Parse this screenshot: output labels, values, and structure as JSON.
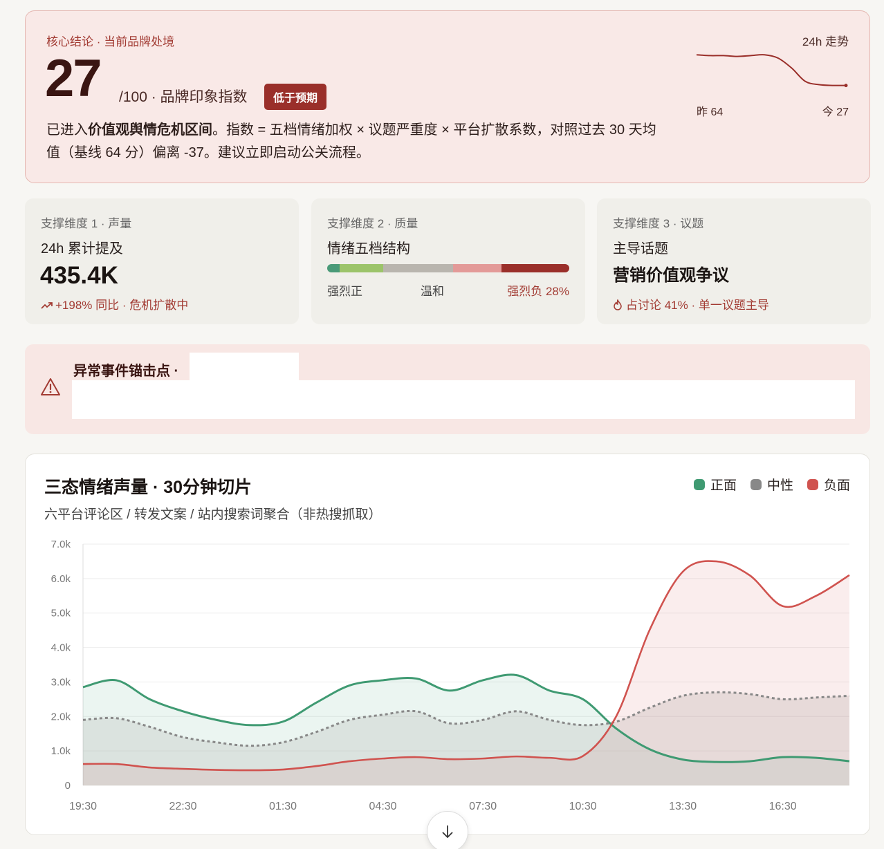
{
  "hero": {
    "kicker": "核心结论 · 当前品牌处境",
    "score": "27",
    "unit": "/100 · 品牌印象指数",
    "badge": "低于预期",
    "desc_pre": "已进入",
    "desc_bold": "价值观舆情危机区间",
    "desc_post": "。指数 = 五档情绪加权 × 议题严重度 × 平台扩散系数，对照过去 30 天均值（基线 64 分）偏离 -37。建议立即启动公关流程。",
    "trend_label": "24h 走势",
    "trend_left": "昨 64",
    "trend_right": "今 27",
    "trend_values": [
      64,
      63,
      63,
      62,
      63,
      64,
      60,
      48,
      32,
      28,
      27,
      27
    ],
    "accent": "#9a2f2a"
  },
  "cards": {
    "volume": {
      "kicker": "支撑维度 1 · 声量",
      "sub": "24h 累计提及",
      "value": "435.4K",
      "note": "+198% 同比 · 危机扩散中"
    },
    "quality": {
      "kicker": "支撑维度 2 · 质量",
      "sub": "情绪五档结构",
      "segments": [
        {
          "name": "强烈正",
          "share": 0.05,
          "color": "#4a9a78"
        },
        {
          "name": "正",
          "share": 0.18,
          "color": "#9cc46a"
        },
        {
          "name": "温和",
          "share": 0.29,
          "color": "#b9b5ae"
        },
        {
          "name": "负",
          "share": 0.2,
          "color": "#e39a98"
        },
        {
          "name": "强烈负",
          "share": 0.28,
          "color": "#9a2f2a"
        }
      ],
      "label_left": "强烈正",
      "label_mid": "温和",
      "label_right": "强烈负 28%"
    },
    "topic": {
      "kicker": "支撑维度 3 · 议题",
      "sub": "主导话题",
      "value": "营销价值观争议",
      "note": "占讨论 41% · 单一议题主导"
    }
  },
  "alert": {
    "title": "异常事件锚击点 ·"
  },
  "chart_card": {
    "title": "三态情绪声量 · 30分钟切片",
    "subtitle": "六平台评论区 / 转发文案 / 站内搜索词聚合（非热搜抓取）"
  },
  "chart_data": {
    "type": "area",
    "x": [
      "19:30",
      "20:30",
      "21:30",
      "22:30",
      "23:30",
      "00:30",
      "01:30",
      "02:30",
      "03:30",
      "04:30",
      "05:30",
      "06:30",
      "07:30",
      "08:30",
      "09:30",
      "10:30",
      "11:30",
      "12:30",
      "13:30",
      "14:30",
      "15:30",
      "16:30",
      "17:30",
      "18:30"
    ],
    "tick_labels": [
      "19:30",
      "22:30",
      "01:30",
      "04:30",
      "07:30",
      "10:30",
      "13:30",
      "16:30"
    ],
    "ylim": [
      0,
      7000
    ],
    "yticks": [
      "0",
      "1.0k",
      "2.0k",
      "3.0k",
      "4.0k",
      "5.0k",
      "6.0k",
      "7.0k"
    ],
    "series": [
      {
        "name": "正面",
        "color": "#3f9a72",
        "values": [
          2850,
          3050,
          2500,
          2150,
          1900,
          1750,
          1850,
          2400,
          2900,
          3050,
          3100,
          2750,
          3050,
          3200,
          2750,
          2500,
          1650,
          1050,
          750,
          680,
          700,
          820,
          800,
          700
        ]
      },
      {
        "name": "中性",
        "color": "#888888",
        "values": [
          1900,
          1950,
          1700,
          1400,
          1250,
          1150,
          1250,
          1550,
          1900,
          2050,
          2150,
          1800,
          1900,
          2150,
          1900,
          1750,
          1850,
          2250,
          2600,
          2700,
          2650,
          2500,
          2550,
          2600
        ]
      },
      {
        "name": "负面",
        "color": "#d0534f",
        "values": [
          620,
          620,
          520,
          480,
          450,
          440,
          460,
          560,
          700,
          780,
          820,
          760,
          780,
          840,
          800,
          850,
          2000,
          4500,
          6200,
          6500,
          6100,
          5200,
          5500,
          6100
        ]
      }
    ]
  }
}
